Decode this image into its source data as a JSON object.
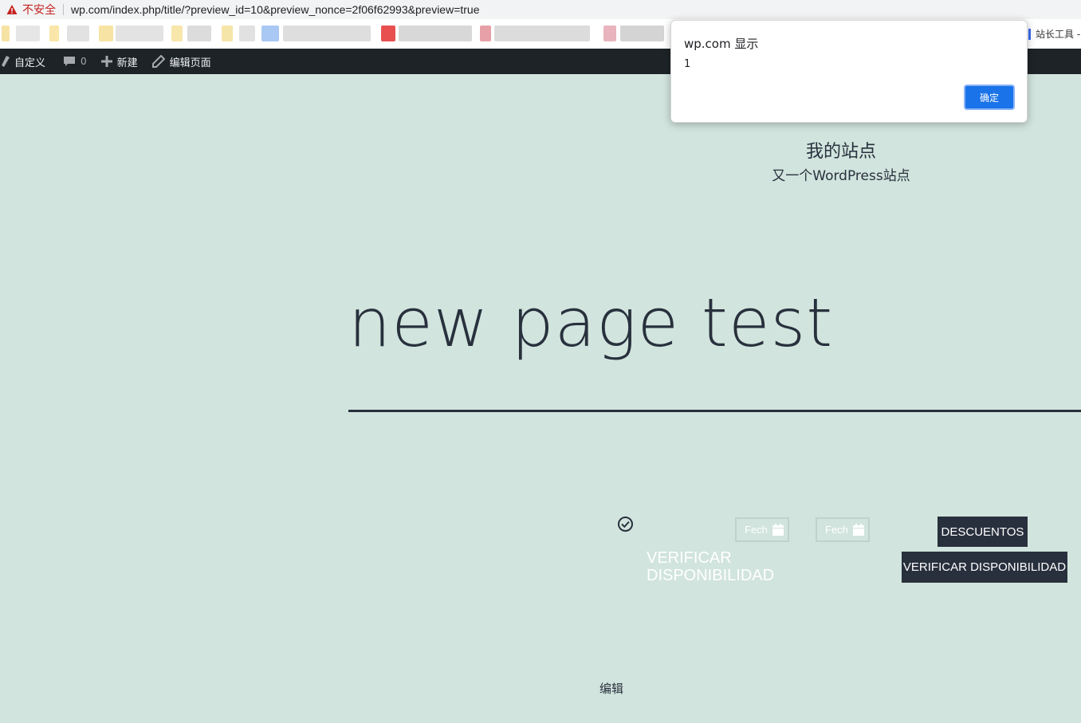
{
  "browser": {
    "security_label": "不安全",
    "url": "wp.com/index.php/title/?preview_id=10&preview_nonce=2f06f62993&preview=true",
    "bookmark_tools_label": "站长工具 -"
  },
  "adminbar": {
    "customize_label": "自定义",
    "comments_count": "0",
    "new_label": "新建",
    "edit_page_label": "编辑页面"
  },
  "site": {
    "title": "我的站点",
    "description": "又一个WordPress站点"
  },
  "page": {
    "title": "new page test"
  },
  "booking": {
    "verify_line1": "VERIFICAR",
    "verify_line2": "DISPONIBILIDAD",
    "date_in_placeholder": "Fech",
    "date_out_placeholder": "Fech",
    "discounts_button": "DESCUENTOS",
    "verify_button": "VERIFICAR DISPONIBILIDAD"
  },
  "footer": {
    "edit_link": "编辑"
  },
  "dialog": {
    "title": "wp.com 显示",
    "message": "1",
    "ok_button": "确定"
  },
  "colors": {
    "page_bg": "#d1e4dd",
    "text_dark": "#28303d",
    "adminbar_bg": "#1d2327",
    "dialog_button": "#1a73e8",
    "insecure_red": "#c5221f"
  }
}
